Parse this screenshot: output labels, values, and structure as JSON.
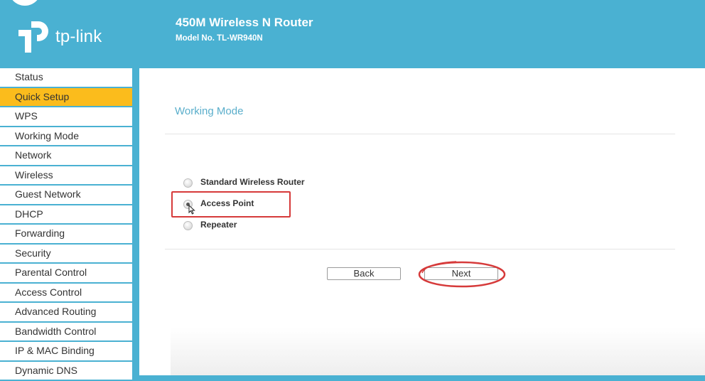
{
  "header": {
    "brand": "tp-link",
    "product_title": "450M Wireless N Router",
    "model": "Model No. TL-WR940N"
  },
  "sidebar": {
    "items": [
      {
        "label": "Status"
      },
      {
        "label": "Quick Setup",
        "active": true
      },
      {
        "label": "WPS"
      },
      {
        "label": "Working Mode"
      },
      {
        "label": "Network"
      },
      {
        "label": "Wireless"
      },
      {
        "label": "Guest Network"
      },
      {
        "label": "DHCP"
      },
      {
        "label": "Forwarding"
      },
      {
        "label": "Security"
      },
      {
        "label": "Parental Control"
      },
      {
        "label": "Access Control"
      },
      {
        "label": "Advanced Routing"
      },
      {
        "label": "Bandwidth Control"
      },
      {
        "label": "IP & MAC Binding"
      },
      {
        "label": "Dynamic DNS"
      }
    ]
  },
  "main": {
    "section_title": "Working Mode",
    "modes": [
      {
        "label": "Standard Wireless Router",
        "checked": false
      },
      {
        "label": "Access Point",
        "checked": true
      },
      {
        "label": "Repeater",
        "checked": false
      }
    ],
    "back_label": "Back",
    "next_label": "Next"
  },
  "colors": {
    "brand_blue": "#4ab1d2",
    "active_item": "#fbbc1c",
    "annotation_red": "#d63a3a"
  }
}
